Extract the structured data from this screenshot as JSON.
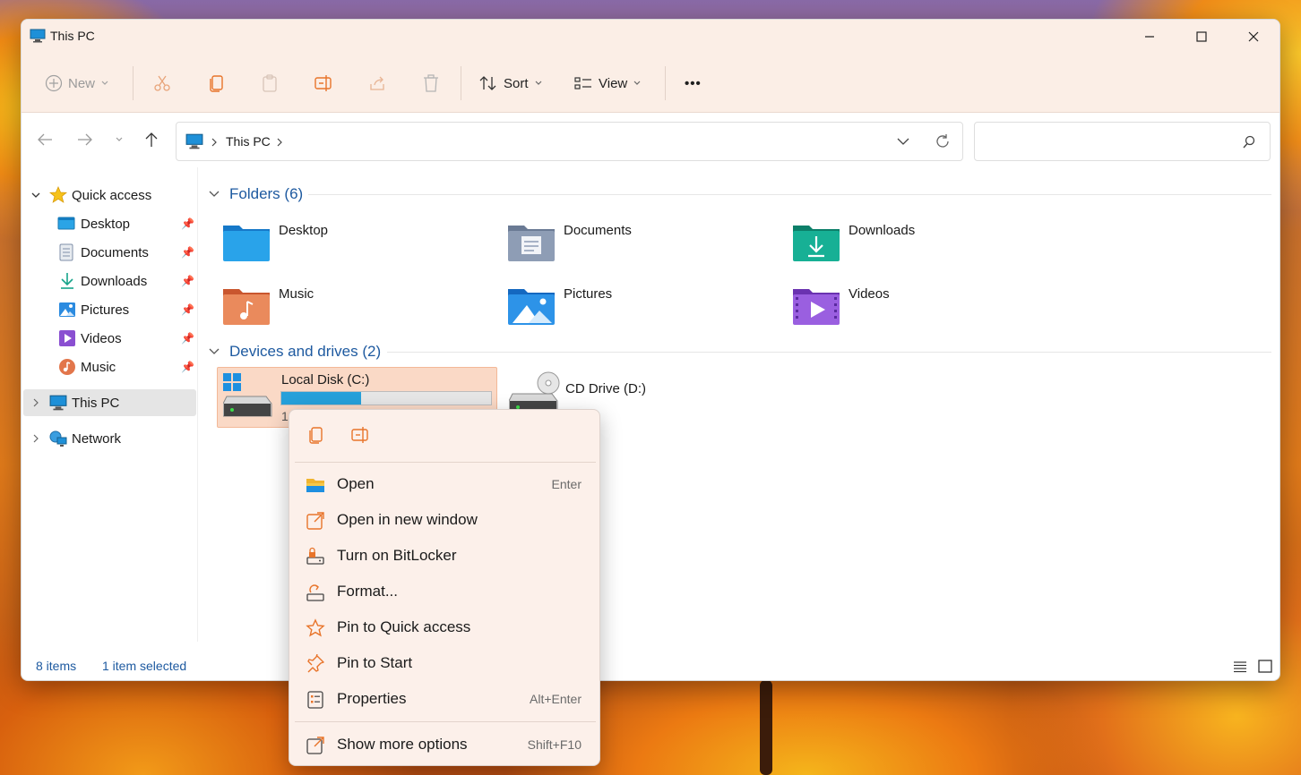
{
  "window": {
    "title": "This PC"
  },
  "toolbar": {
    "new_label": "New",
    "sort_label": "Sort",
    "view_label": "View",
    "more_label": "•••"
  },
  "navigation": {
    "breadcrumb": [
      "This PC"
    ],
    "search_placeholder": ""
  },
  "sidebar": {
    "quick_access_label": "Quick access",
    "quick_items": [
      {
        "label": "Desktop",
        "icon": "desktop-icon"
      },
      {
        "label": "Documents",
        "icon": "documents-icon"
      },
      {
        "label": "Downloads",
        "icon": "downloads-icon"
      },
      {
        "label": "Pictures",
        "icon": "pictures-icon"
      },
      {
        "label": "Videos",
        "icon": "videos-icon"
      },
      {
        "label": "Music",
        "icon": "music-icon"
      }
    ],
    "this_pc_label": "This PC",
    "network_label": "Network"
  },
  "content": {
    "folders_header": "Folders (6)",
    "folders": [
      {
        "label": "Desktop",
        "color": "#1e8fd9"
      },
      {
        "label": "Documents",
        "color": "#7f8fa8"
      },
      {
        "label": "Downloads",
        "color": "#16a38a"
      },
      {
        "label": "Music",
        "color": "#e2764b"
      },
      {
        "label": "Pictures",
        "color": "#2b8be0"
      },
      {
        "label": "Videos",
        "color": "#8a4fd1"
      }
    ],
    "drives_header": "Devices and drives (2)",
    "drives": [
      {
        "label": "Local Disk (C:)",
        "usage_fraction": 0.38,
        "partial_text": "1"
      },
      {
        "label": "CD Drive (D:)"
      }
    ]
  },
  "status": {
    "items_count": "8 items",
    "selected": "1 item selected"
  },
  "context_menu": {
    "items": [
      {
        "label": "Open",
        "shortcut": "Enter",
        "icon": "open-folder-icon"
      },
      {
        "label": "Open in new window",
        "shortcut": "",
        "icon": "new-window-icon"
      },
      {
        "label": "Turn on BitLocker",
        "shortcut": "",
        "icon": "bitlocker-icon"
      },
      {
        "label": "Format...",
        "shortcut": "",
        "icon": "format-icon"
      },
      {
        "label": "Pin to Quick access",
        "shortcut": "",
        "icon": "star-icon"
      },
      {
        "label": "Pin to Start",
        "shortcut": "",
        "icon": "pin-icon"
      },
      {
        "label": "Properties",
        "shortcut": "Alt+Enter",
        "icon": "properties-icon"
      },
      {
        "label": "Show more options",
        "shortcut": "Shift+F10",
        "icon": "more-options-icon"
      }
    ]
  },
  "colors": {
    "accent": "#1e5aa0",
    "selection": "#fad9c6",
    "drive_bar": "#26a0da",
    "icon_orange": "#e8742a"
  }
}
